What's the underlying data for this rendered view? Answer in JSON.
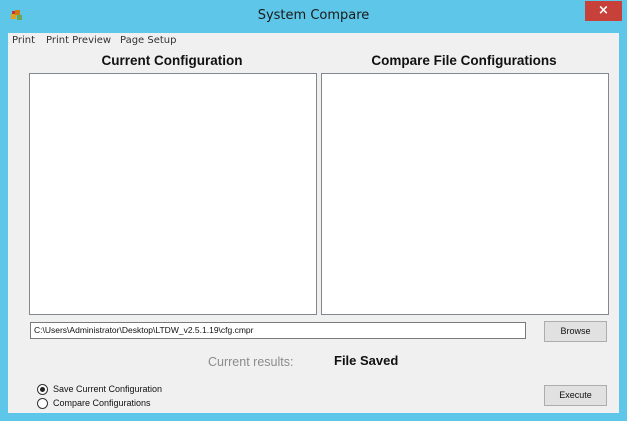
{
  "window": {
    "title": "System Compare",
    "close_label": "×"
  },
  "menu": {
    "items": [
      "Print",
      "Print Preview",
      "Page Setup"
    ]
  },
  "panels": {
    "current_heading": "Current Configuration",
    "compare_heading": "Compare File Configurations"
  },
  "file": {
    "path": "C:\\Users\\Administrator\\Desktop\\LTDW_v2.5.1.19\\cfg.cmpr",
    "browse_label": "Browse"
  },
  "results": {
    "label": "Current results:",
    "value": "File Saved"
  },
  "mode": {
    "options": [
      "Save Current Configuration",
      "Compare Configurations"
    ],
    "selected": "Save Current Configuration"
  },
  "actions": {
    "execute_label": "Execute"
  },
  "colors": {
    "titlebar": "#5ec6e8",
    "close_button": "#c8403a",
    "client_background": "#f0f0f0"
  }
}
